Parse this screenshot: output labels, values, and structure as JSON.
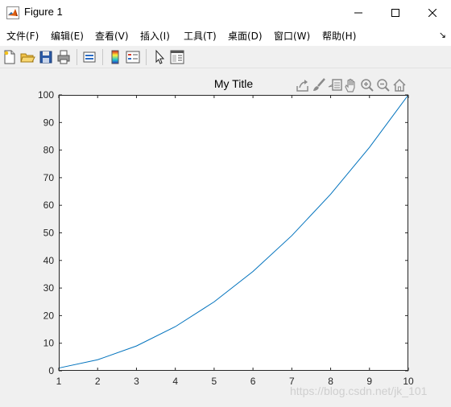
{
  "window": {
    "title": "Figure 1",
    "icons": {
      "app": "matlab-logo-icon",
      "minimize": "minimize-icon",
      "maximize": "maximize-icon",
      "close": "close-icon"
    }
  },
  "menu": {
    "items": [
      {
        "label": "文件(F)"
      },
      {
        "label": "编辑(E)"
      },
      {
        "label": "查看(V)"
      },
      {
        "label": "插入(I)"
      },
      {
        "label": "工具(T)"
      },
      {
        "label": "桌面(D)"
      },
      {
        "label": "窗口(W)"
      },
      {
        "label": "帮助(H)"
      }
    ],
    "dock_arrow": "↘"
  },
  "toolbar": {
    "icons": [
      "new-figure-icon",
      "open-file-icon",
      "save-icon",
      "print-icon",
      "link-plot-icon",
      "colorbar-icon",
      "legend-icon",
      "edit-plot-arrow-icon",
      "property-inspector-icon"
    ]
  },
  "axes_toolbar": {
    "icons": [
      "export-icon",
      "brush-icon",
      "data-tips-icon",
      "pan-icon",
      "zoom-in-icon",
      "zoom-out-icon",
      "home-icon"
    ]
  },
  "colors": {
    "line": "#0072bd",
    "axes_bg": "#ffffff",
    "figure_bg": "#f0f0f0"
  },
  "chart_data": {
    "type": "line",
    "title": "My Title",
    "xlabel": "",
    "ylabel": "",
    "x": [
      1,
      2,
      3,
      4,
      5,
      6,
      7,
      8,
      9,
      10
    ],
    "series": [
      {
        "values": [
          1,
          4,
          9,
          16,
          25,
          36,
          49,
          64,
          81,
          100
        ]
      }
    ],
    "xlim": [
      1,
      10
    ],
    "ylim": [
      0,
      100
    ],
    "xticks": [
      "1",
      "2",
      "3",
      "4",
      "5",
      "6",
      "7",
      "8",
      "9",
      "10"
    ],
    "yticks": [
      "0",
      "10",
      "20",
      "30",
      "40",
      "50",
      "60",
      "70",
      "80",
      "90",
      "100"
    ],
    "grid": false,
    "box": true
  },
  "watermark": "https://blog.csdn.net/jk_101"
}
